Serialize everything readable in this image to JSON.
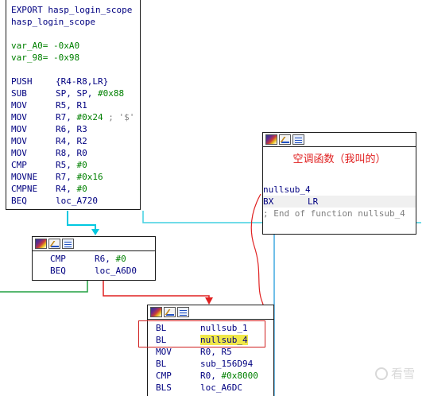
{
  "node1": {
    "lines": [
      {
        "text": "EXPORT hasp_login_scope"
      },
      {
        "text": "hasp_login_scope"
      },
      {
        "text": ""
      },
      {
        "text": "var_A0= -0xA0",
        "green": true
      },
      {
        "text": "var_98= -0x98",
        "green": true
      },
      {
        "text": ""
      },
      {
        "mn": "PUSH",
        "op": "{R4-R8,LR}"
      },
      {
        "mn": "SUB",
        "op": "SP, SP, ",
        "num": "#0x88"
      },
      {
        "mn": "MOV",
        "op": "R5, R1"
      },
      {
        "mn": "MOV",
        "op": "R7, ",
        "num": "#0x24",
        "cmt": " ; '$'"
      },
      {
        "mn": "MOV",
        "op": "R6, R3"
      },
      {
        "mn": "MOV",
        "op": "R4, R2"
      },
      {
        "mn": "MOV",
        "op": "R8, R0"
      },
      {
        "mn": "CMP",
        "op": "R5, ",
        "num": "#0"
      },
      {
        "mn": "MOVNE",
        "op": "R7, ",
        "num": "#0x16"
      },
      {
        "mn": "CMPNE",
        "op": "R4, ",
        "num": "#0"
      },
      {
        "mn": "BEQ",
        "op": "loc_A720"
      }
    ]
  },
  "node2": {
    "lines": [
      {
        "mn": "CMP",
        "op": "R6, ",
        "num": "#0"
      },
      {
        "mn": "BEQ",
        "op": "loc_A6D0"
      }
    ]
  },
  "node3": {
    "caption": "空调函数（我叫的）",
    "lines": [
      {
        "text": "nullsub_4"
      },
      {
        "mn": "BX",
        "op": "LR",
        "hl": true
      },
      {
        "text": "; End of function nullsub_4",
        "comment": true
      }
    ]
  },
  "node4": {
    "lines": [
      {
        "mn": "BL",
        "op": "nullsub_1"
      },
      {
        "mn": "BL",
        "op": "nullsub_4",
        "yellow": true
      },
      {
        "mn": "MOV",
        "op": "R0, R5"
      },
      {
        "mn": "BL",
        "op": "sub_156D94"
      },
      {
        "mn": "CMP",
        "op": "R0, ",
        "num": "#0x8000"
      },
      {
        "mn": "BLS",
        "op": "loc_A6DC"
      }
    ]
  },
  "watermark": {
    "text": "看雪"
  },
  "colors": {
    "edge_true": "#00c8e0",
    "edge_false": "#e02020",
    "edge_green": "#20a040",
    "edge_cyan": "#40d0e0"
  }
}
